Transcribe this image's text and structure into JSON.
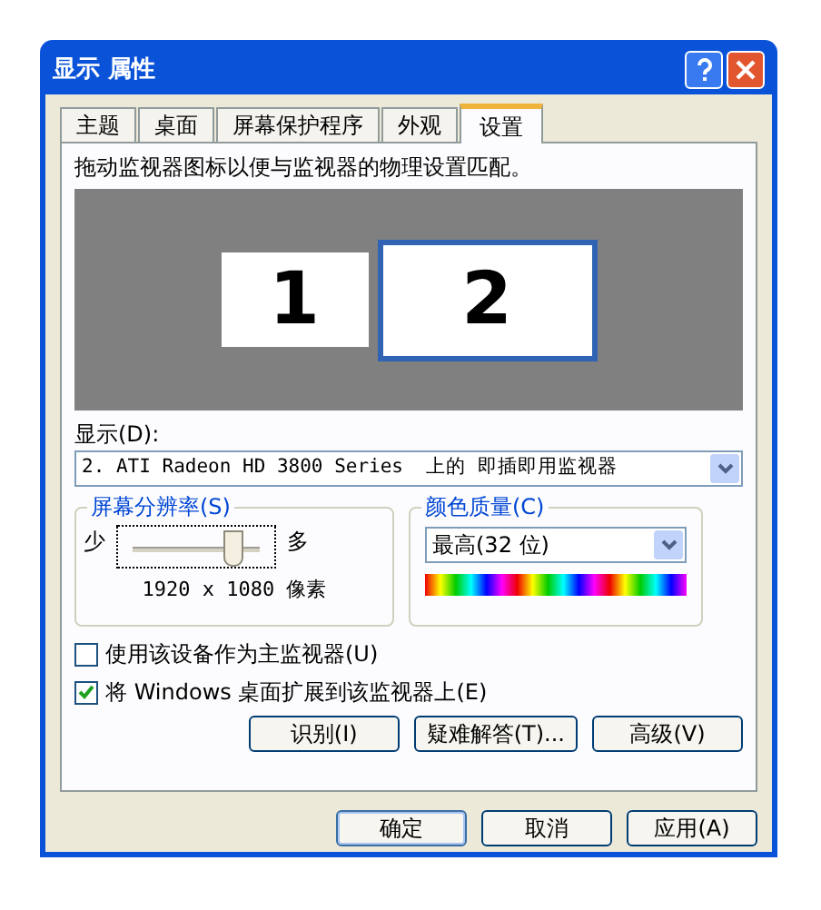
{
  "window": {
    "title": "显示 属性"
  },
  "tabs": [
    {
      "label": "主题",
      "selected": false
    },
    {
      "label": "桌面",
      "selected": false
    },
    {
      "label": "屏幕保护程序",
      "selected": false
    },
    {
      "label": "外观",
      "selected": false
    },
    {
      "label": "设置",
      "selected": true
    }
  ],
  "instruction": "拖动监视器图标以便与监视器的物理设置匹配。",
  "monitors": [
    {
      "label": "1",
      "selected": false
    },
    {
      "label": "2",
      "selected": true
    }
  ],
  "display": {
    "label": "显示(D):",
    "value": "2. ATI Radeon HD 3800 Series  上的 即插即用监视器"
  },
  "resolution": {
    "title": "屏幕分辨率(S)",
    "min_label": "少",
    "max_label": "多",
    "level": 0.78,
    "reading": "1920 x 1080 像素"
  },
  "color_quality": {
    "title": "颜色质量(C)",
    "value": "最高(32 位)"
  },
  "checkboxes": [
    {
      "label": "使用该设备作为主监视器(U)",
      "checked": false
    },
    {
      "label": "将 Windows 桌面扩展到该监视器上(E)",
      "checked": true
    }
  ],
  "action_buttons": [
    "识别(I)",
    "疑难解答(T)...",
    "高级(V)"
  ],
  "dialog_buttons": [
    "确定",
    "取消",
    "应用(A)"
  ]
}
